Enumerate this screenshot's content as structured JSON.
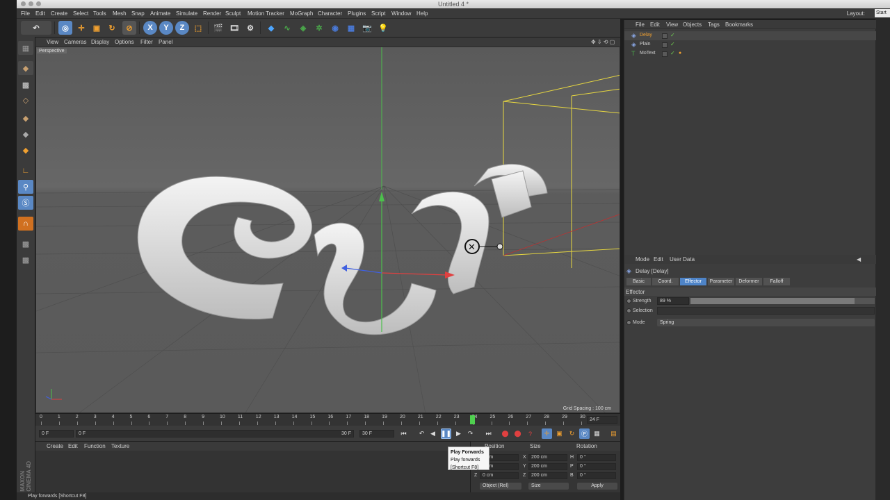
{
  "window": {
    "title": "Untitled 4 *"
  },
  "menubar": {
    "items": [
      "File",
      "Edit",
      "Create",
      "Select",
      "Tools",
      "Mesh",
      "Snap",
      "Animate",
      "Simulate",
      "Render",
      "Sculpt",
      "Motion Tracker",
      "MoGraph",
      "Character",
      "Plugins",
      "Script",
      "Window",
      "Help"
    ],
    "layout_label": "Layout:",
    "layout_value": "Start"
  },
  "toolbar": {
    "axis_x": "X",
    "axis_y": "Y",
    "axis_z": "Z"
  },
  "viewport": {
    "menu": [
      "View",
      "Cameras",
      "Display",
      "Options",
      "Filter",
      "Panel"
    ],
    "camera_label": "Perspective",
    "grid_spacing": "Grid Spacing : 100 cm"
  },
  "timeline": {
    "frames": [
      "0",
      "1",
      "2",
      "3",
      "4",
      "5",
      "6",
      "7",
      "8",
      "9",
      "10",
      "11",
      "12",
      "13",
      "14",
      "15",
      "16",
      "17",
      "18",
      "19",
      "20",
      "21",
      "22",
      "23",
      "24",
      "25",
      "26",
      "27",
      "28",
      "29",
      "30"
    ],
    "current_frame": "24 F",
    "start_field": "0 F",
    "range_start": "0 F",
    "range_end": "30 F",
    "end_field": "30 F"
  },
  "material_manager": {
    "menu": [
      "Create",
      "Edit",
      "Function",
      "Texture"
    ]
  },
  "coordinates": {
    "headers": {
      "position": "Position",
      "size": "Size",
      "rotation": "Rotation"
    },
    "rows": [
      {
        "axis": "X",
        "pos": "0 cm",
        "size_axis": "X",
        "size": "200 cm",
        "rot_axis": "H",
        "rot": "0 °"
      },
      {
        "axis": "Y",
        "pos": "0 cm",
        "size_axis": "Y",
        "size": "200 cm",
        "rot_axis": "P",
        "rot": "0 °"
      },
      {
        "axis": "Z",
        "pos": "0 cm",
        "size_axis": "Z",
        "size": "200 cm",
        "rot_axis": "B",
        "rot": "0 °"
      }
    ],
    "mode_select": "Object (Rel)",
    "size_select": "Size",
    "apply_label": "Apply"
  },
  "tooltip": {
    "title": "Play Forwards",
    "line1": "Play forwards",
    "line2": "[Shortcut F8]"
  },
  "statusbar": {
    "text": "Play forwards [Shortcut F8]"
  },
  "object_manager": {
    "menu": [
      "File",
      "Edit",
      "View",
      "Objects",
      "Tags",
      "Bookmarks"
    ],
    "objects": [
      {
        "name": "Delay",
        "selected": true
      },
      {
        "name": "Plain",
        "selected": false
      },
      {
        "name": "MoText",
        "selected": false
      }
    ]
  },
  "attribute_manager": {
    "menu": [
      "Mode",
      "Edit",
      "User Data"
    ],
    "object_title": "Delay [Delay]",
    "tabs": [
      "Basic",
      "Coord.",
      "Effector",
      "Parameter",
      "Deformer",
      "Falloff"
    ],
    "active_tab": "Effector",
    "section": "Effector",
    "strength_label": "Strength",
    "strength_value": "89 %",
    "strength_fraction": 0.89,
    "selection_label": "Selection",
    "mode_label": "Mode",
    "mode_value": "Spring"
  },
  "colors": {
    "accent_blue": "#4e84c8",
    "selected_object": "#f0a030",
    "check_green": "#6fcf4f",
    "playhead_green": "#4fd04f"
  }
}
